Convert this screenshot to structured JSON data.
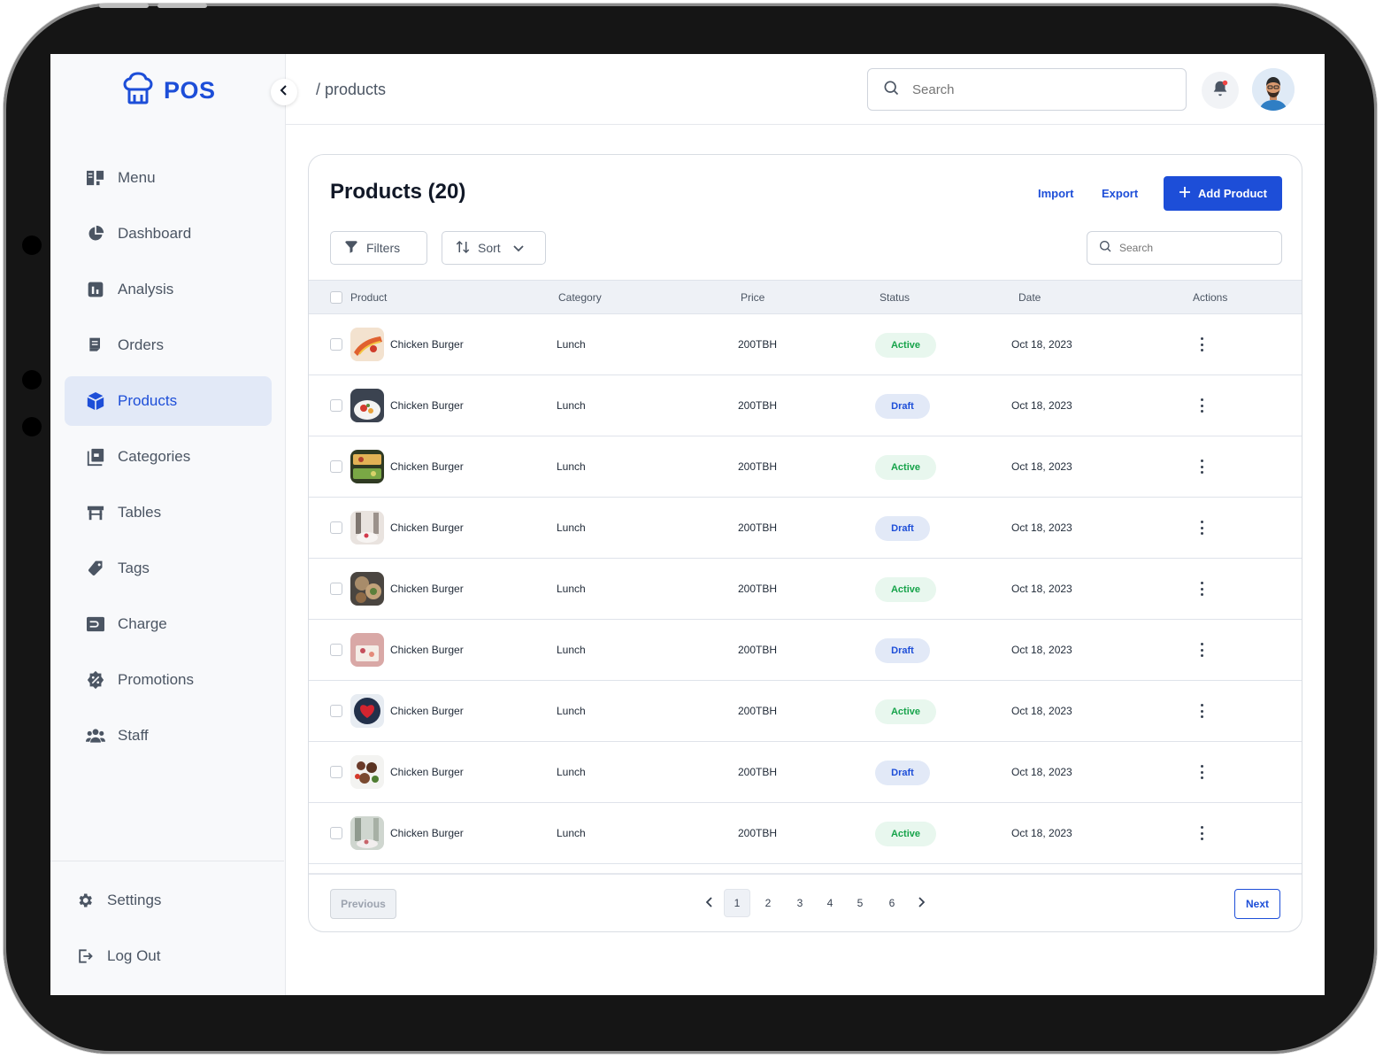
{
  "app": {
    "logo_text": "POS"
  },
  "sidebar": {
    "items": [
      {
        "label": "Menu",
        "icon": "menu-book-icon"
      },
      {
        "label": "Dashboard",
        "icon": "pie-chart-icon"
      },
      {
        "label": "Analysis",
        "icon": "bar-chart-icon"
      },
      {
        "label": "Orders",
        "icon": "receipt-icon"
      },
      {
        "label": "Products",
        "icon": "cube-icon",
        "active": true
      },
      {
        "label": "Categories",
        "icon": "category-icon"
      },
      {
        "label": "Tables",
        "icon": "table-icon"
      },
      {
        "label": "Tags",
        "icon": "tag-icon"
      },
      {
        "label": "Charge",
        "icon": "wallet-icon"
      },
      {
        "label": "Promotions",
        "icon": "discount-icon"
      },
      {
        "label": "Staff",
        "icon": "users-icon"
      }
    ],
    "bottom": [
      {
        "label": "Settings",
        "icon": "gear-icon"
      },
      {
        "label": "Log Out",
        "icon": "logout-icon"
      }
    ]
  },
  "header": {
    "breadcrumb": "/ products",
    "search_placeholder": "Search"
  },
  "products": {
    "title": "Products (20)",
    "import_label": "Import",
    "export_label": "Export",
    "add_label": "Add Product",
    "filters_label": "Filters",
    "sort_label": "Sort",
    "search_placeholder": "Search",
    "columns": {
      "product": "Product",
      "category": "Category",
      "price": "Price",
      "status": "Status",
      "date": "Date",
      "actions": "Actions"
    },
    "rows": [
      {
        "name": "Chicken Burger",
        "category": "Lunch",
        "price": "200TBH",
        "status": "Active",
        "date": "Oct 18, 2023"
      },
      {
        "name": "Chicken Burger",
        "category": "Lunch",
        "price": "200TBH",
        "status": "Draft",
        "date": "Oct 18, 2023"
      },
      {
        "name": "Chicken Burger",
        "category": "Lunch",
        "price": "200TBH",
        "status": "Active",
        "date": "Oct 18, 2023"
      },
      {
        "name": "Chicken Burger",
        "category": "Lunch",
        "price": "200TBH",
        "status": "Draft",
        "date": "Oct 18, 2023"
      },
      {
        "name": "Chicken Burger",
        "category": "Lunch",
        "price": "200TBH",
        "status": "Active",
        "date": "Oct 18, 2023"
      },
      {
        "name": "Chicken Burger",
        "category": "Lunch",
        "price": "200TBH",
        "status": "Draft",
        "date": "Oct 18, 2023"
      },
      {
        "name": "Chicken Burger",
        "category": "Lunch",
        "price": "200TBH",
        "status": "Active",
        "date": "Oct 18, 2023"
      },
      {
        "name": "Chicken Burger",
        "category": "Lunch",
        "price": "200TBH",
        "status": "Draft",
        "date": "Oct 18, 2023"
      },
      {
        "name": "Chicken Burger",
        "category": "Lunch",
        "price": "200TBH",
        "status": "Active",
        "date": "Oct 18, 2023"
      }
    ]
  },
  "pagination": {
    "previous_label": "Previous",
    "next_label": "Next",
    "pages": [
      "1",
      "2",
      "3",
      "4",
      "5",
      "6"
    ],
    "current": "1"
  },
  "colors": {
    "accent": "#1d4ed8",
    "active_bg": "#e8f7ee",
    "active_fg": "#16a34a",
    "draft_bg": "#e2e9f7"
  }
}
